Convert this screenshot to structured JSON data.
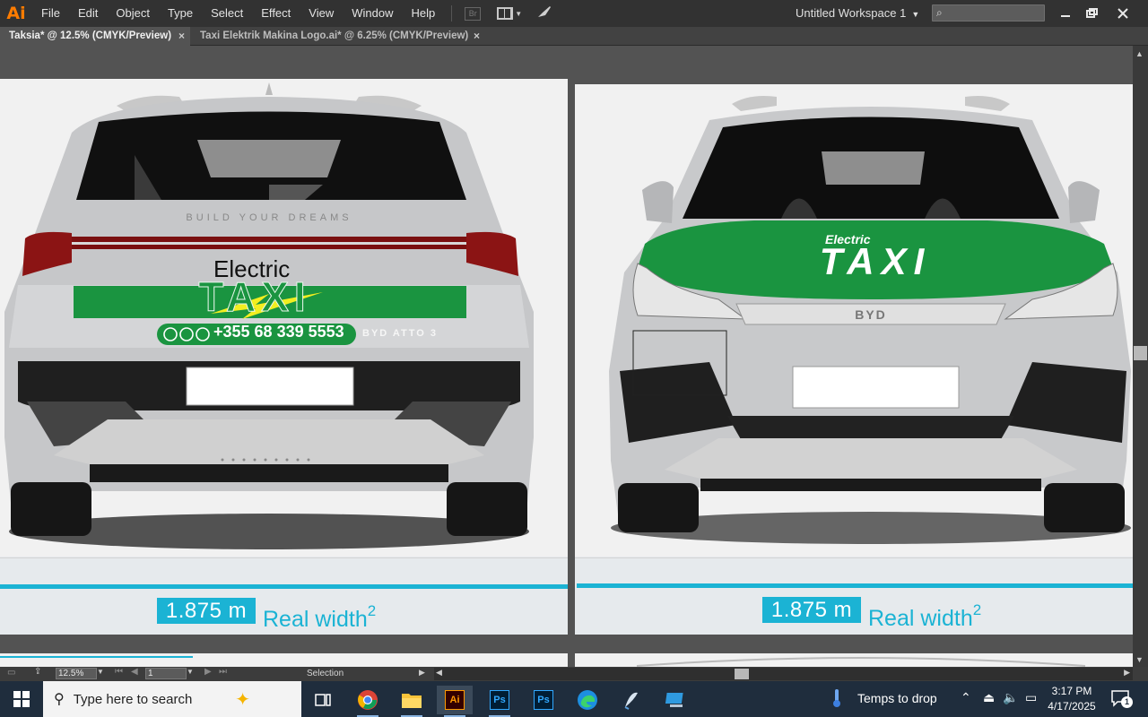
{
  "app": {
    "logo": "Ai",
    "menu": [
      "File",
      "Edit",
      "Object",
      "Type",
      "Select",
      "Effect",
      "View",
      "Window",
      "Help"
    ],
    "bridge_label": "Br",
    "workspace": "Untitled Workspace 1"
  },
  "tabs": [
    {
      "label": "Taksia* @ 12.5% (CMYK/Preview)",
      "active": true
    },
    {
      "label": "Taxi Elektrik Makina Logo.ai* @ 6.25% (CMYK/Preview)",
      "active": false
    }
  ],
  "artboards": {
    "rear": {
      "brand_text": "Electric",
      "taxi_text": "TAXI",
      "phone": "+355 68 339 5553",
      "model_badge": "BYD ATTO 3",
      "width_value": "1.875 m",
      "width_label": "Real width",
      "width_sup": "2"
    },
    "front": {
      "brand_text": "Electric",
      "taxi_text": "TAXI",
      "badge": "BYD",
      "width_value": "1.875 m",
      "width_label": "Real width",
      "width_sup": "2"
    }
  },
  "status": {
    "zoom": "12.5%",
    "page": "1",
    "tool": "Selection"
  },
  "taskbar": {
    "search_placeholder": "Type here to search",
    "weather": "Temps to drop",
    "time": "3:17 PM",
    "date": "4/17/2025",
    "notifications": "1"
  },
  "colors": {
    "accent": "#1bb3d4",
    "taxi_green": "#1a9440",
    "ai_orange": "#ff7c00"
  }
}
